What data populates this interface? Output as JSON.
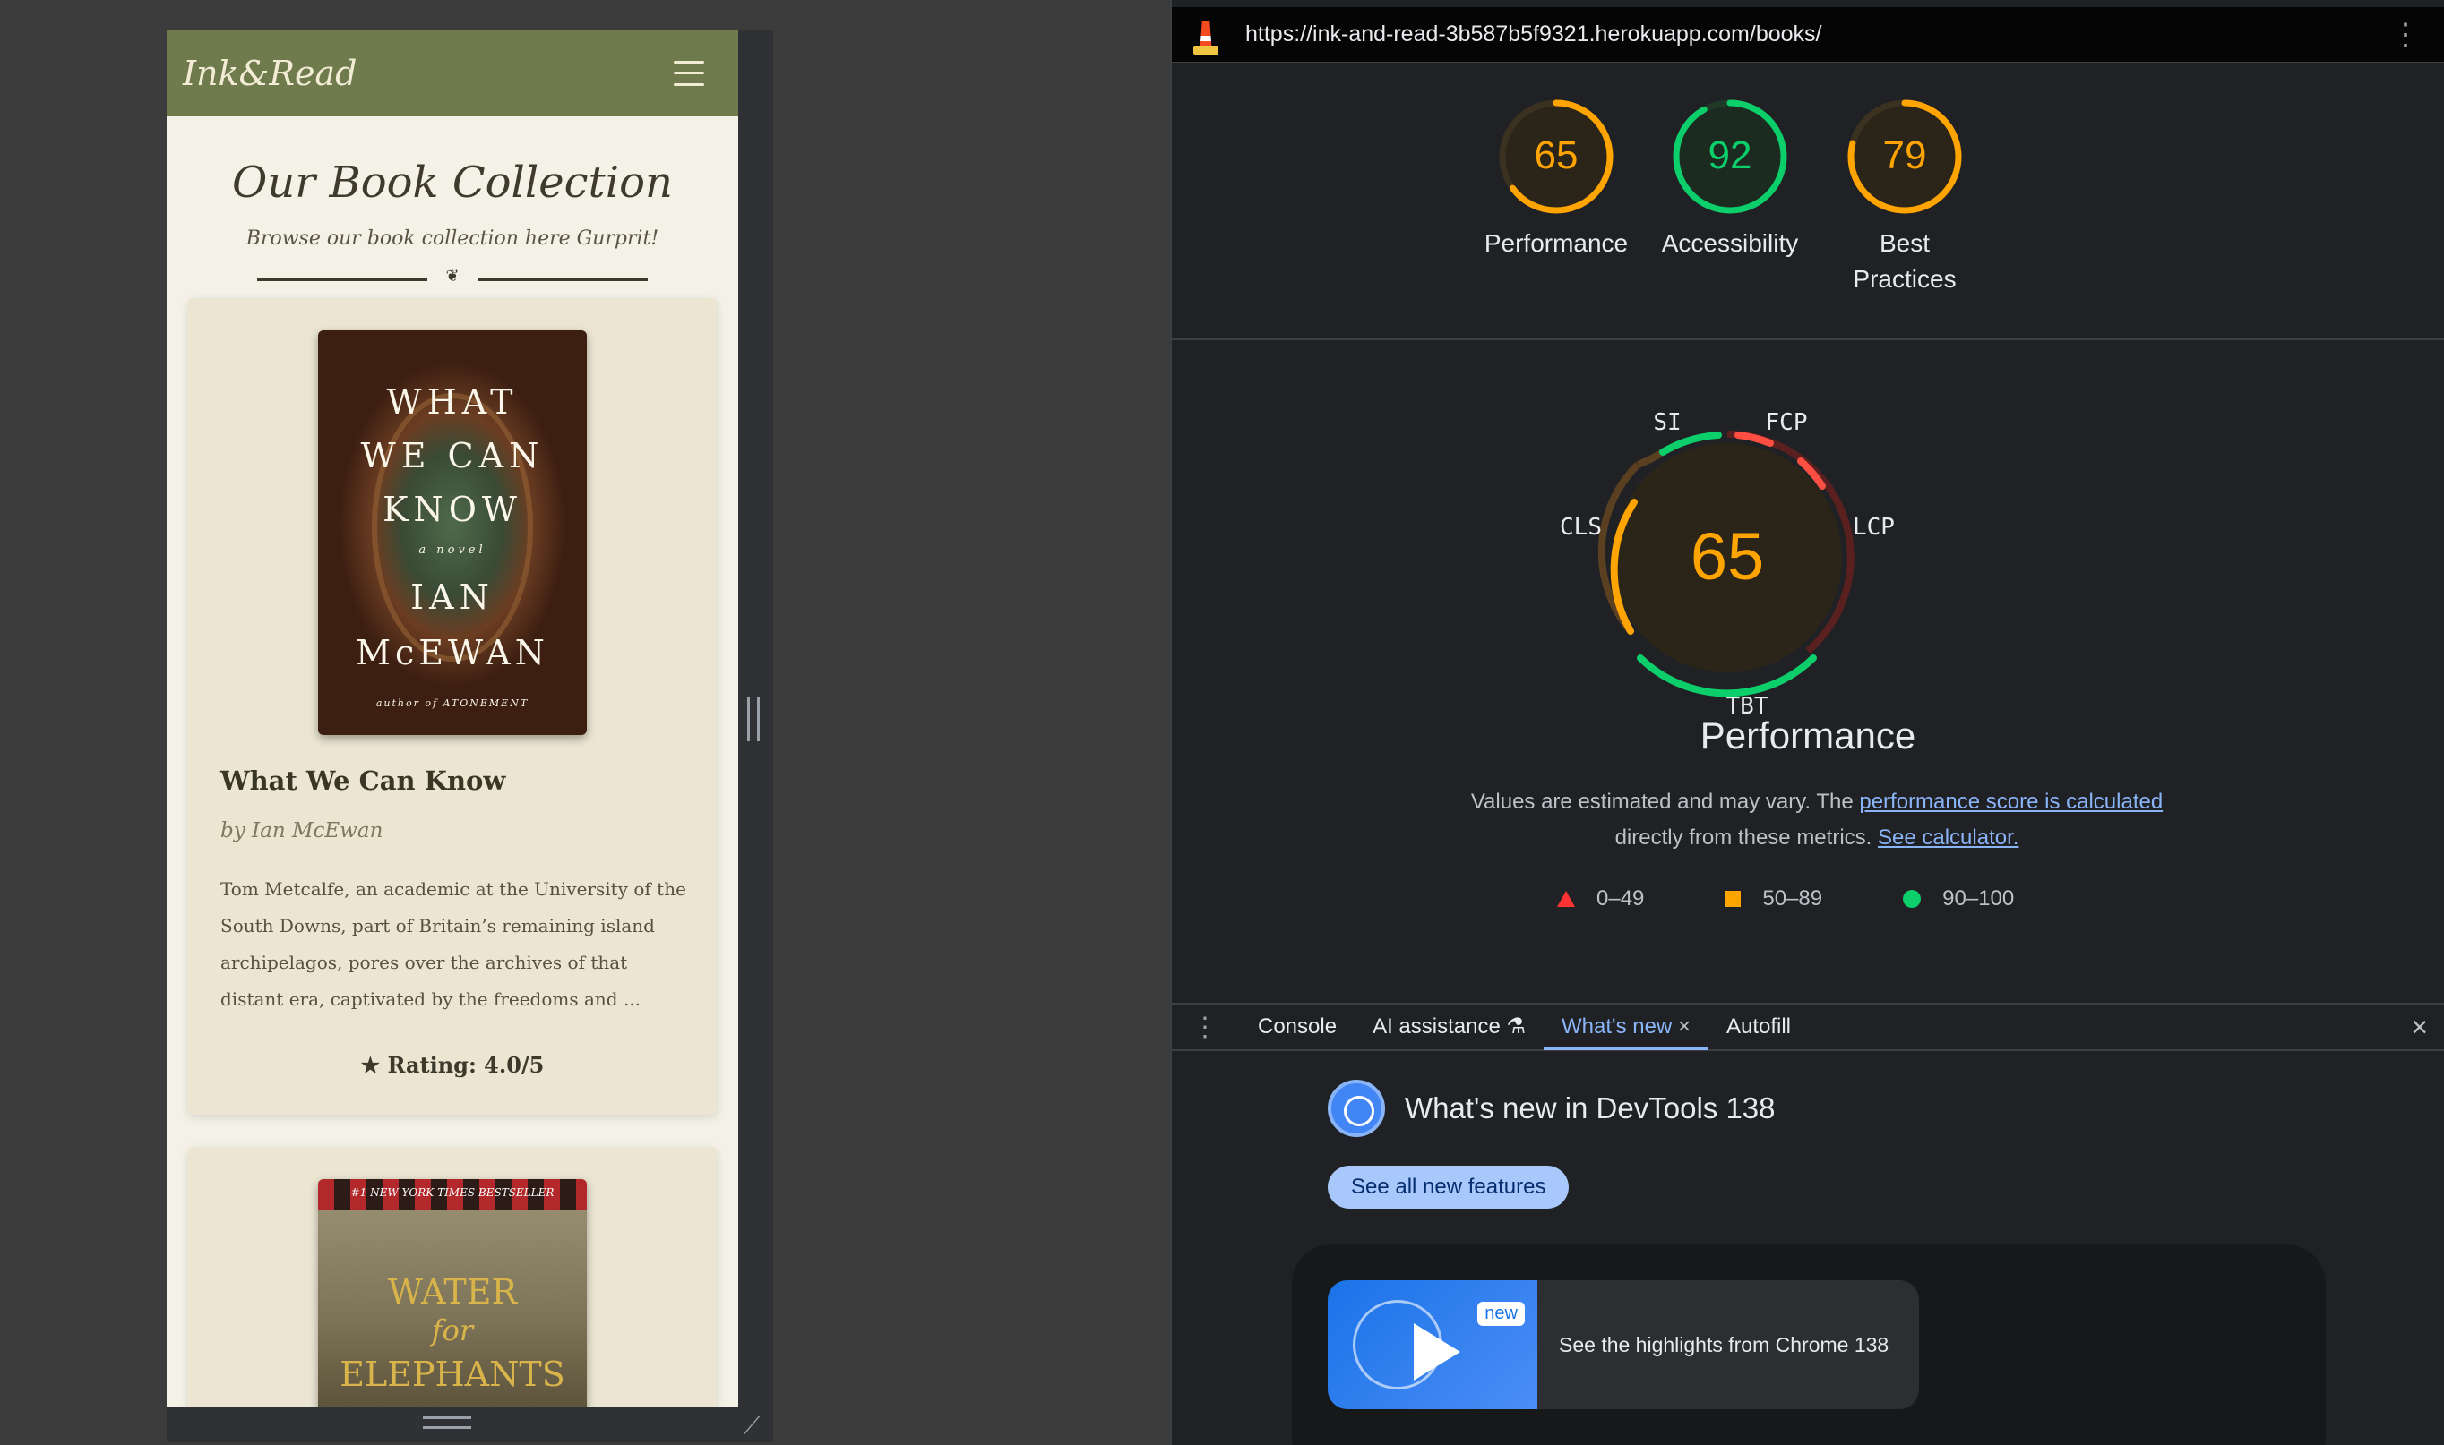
{
  "site": {
    "brand": "Ink&Read",
    "page_title": "Our Book Collection",
    "page_subtitle": "Browse our book collection here Gurprit!",
    "books": [
      {
        "title": "What We Can Know",
        "author": "by Ian McEwan",
        "description": "Tom Metcalfe, an academic at the University of the South Downs, part of Britain’s remaining island archipelagos, pores over the archives of that distant era, captivated by the freedoms and ...",
        "rating": "★ Rating: 4.0/5",
        "cover_text": {
          "line1": "WHAT",
          "line2": "WE CAN",
          "line3": "KNOW",
          "tagline": "a novel",
          "author_first": "IAN",
          "author_last": "McEWAN",
          "blurb": "author of ATONEMENT"
        }
      },
      {
        "cover_text": {
          "badge": "#1 NEW YORK TIMES BESTSELLER",
          "word1": "WATER",
          "word2": "for",
          "word3": "ELEPHANTS"
        }
      }
    ]
  },
  "devtools": {
    "url": "https://ink-and-read-3b587b5f9321.herokuapp.com/books/",
    "scores": [
      {
        "label": "Performance",
        "value": "65",
        "score": 65,
        "color": "#ffa400"
      },
      {
        "label": "Accessibility",
        "value": "92",
        "score": 92,
        "color": "#0cce6b"
      },
      {
        "label": "Best Practices",
        "value": "79",
        "score": 79,
        "color": "#ffa400"
      }
    ],
    "big_gauge": {
      "score": "65",
      "metrics": {
        "si": "SI",
        "fcp": "FCP",
        "lcp": "LCP",
        "tbt": "TBT",
        "cls": "CLS"
      },
      "title": "Performance"
    },
    "notice": {
      "text1": "Values are estimated and may vary. The ",
      "link1": "performance score is calculated",
      "text2": " directly from these metrics. ",
      "link2": "See calculator."
    },
    "legend": {
      "fail": "0–49",
      "average": "50–89",
      "pass": "90–100"
    },
    "drawer": {
      "tabs": [
        "Console",
        "AI assistance",
        "What's new",
        "Autofill"
      ],
      "ai_icon": "flask-icon",
      "active_tab_close": "×",
      "close": "×"
    },
    "whats_new": {
      "title": "What's new in DevTools 138",
      "button": "See all new features",
      "video_badge": "new",
      "video_text": "See the highlights from Chrome 138"
    }
  }
}
